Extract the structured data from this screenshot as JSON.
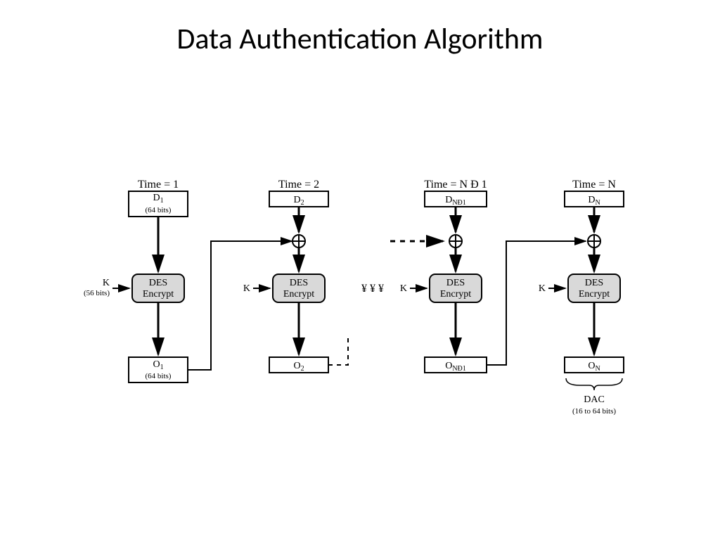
{
  "title": "Data Authentication Algorithm",
  "keyLabel": "K",
  "keyBits": "(56 bits)",
  "desLabel1": "DES",
  "desLabel2": "Encrypt",
  "inputBits": "(64 bits)",
  "outputBits": "(64 bits)",
  "dacLabel": "DAC",
  "dacBits": "(16 to 64 bits)",
  "stages": [
    {
      "time": "Time = 1",
      "d": "D",
      "dsub": "1",
      "o": "O",
      "osub": "1"
    },
    {
      "time": "Time = 2",
      "d": "D",
      "dsub": "2",
      "o": "O",
      "osub": "2"
    },
    {
      "time": "Time = N Ð 1",
      "d": "D",
      "dsub": "NÐ1",
      "o": "O",
      "osub": "NÐ1"
    },
    {
      "time": "Time = N",
      "d": "D",
      "dsub": "N",
      "o": "O",
      "osub": "N"
    }
  ],
  "ellipsis": "¥   ¥   ¥"
}
